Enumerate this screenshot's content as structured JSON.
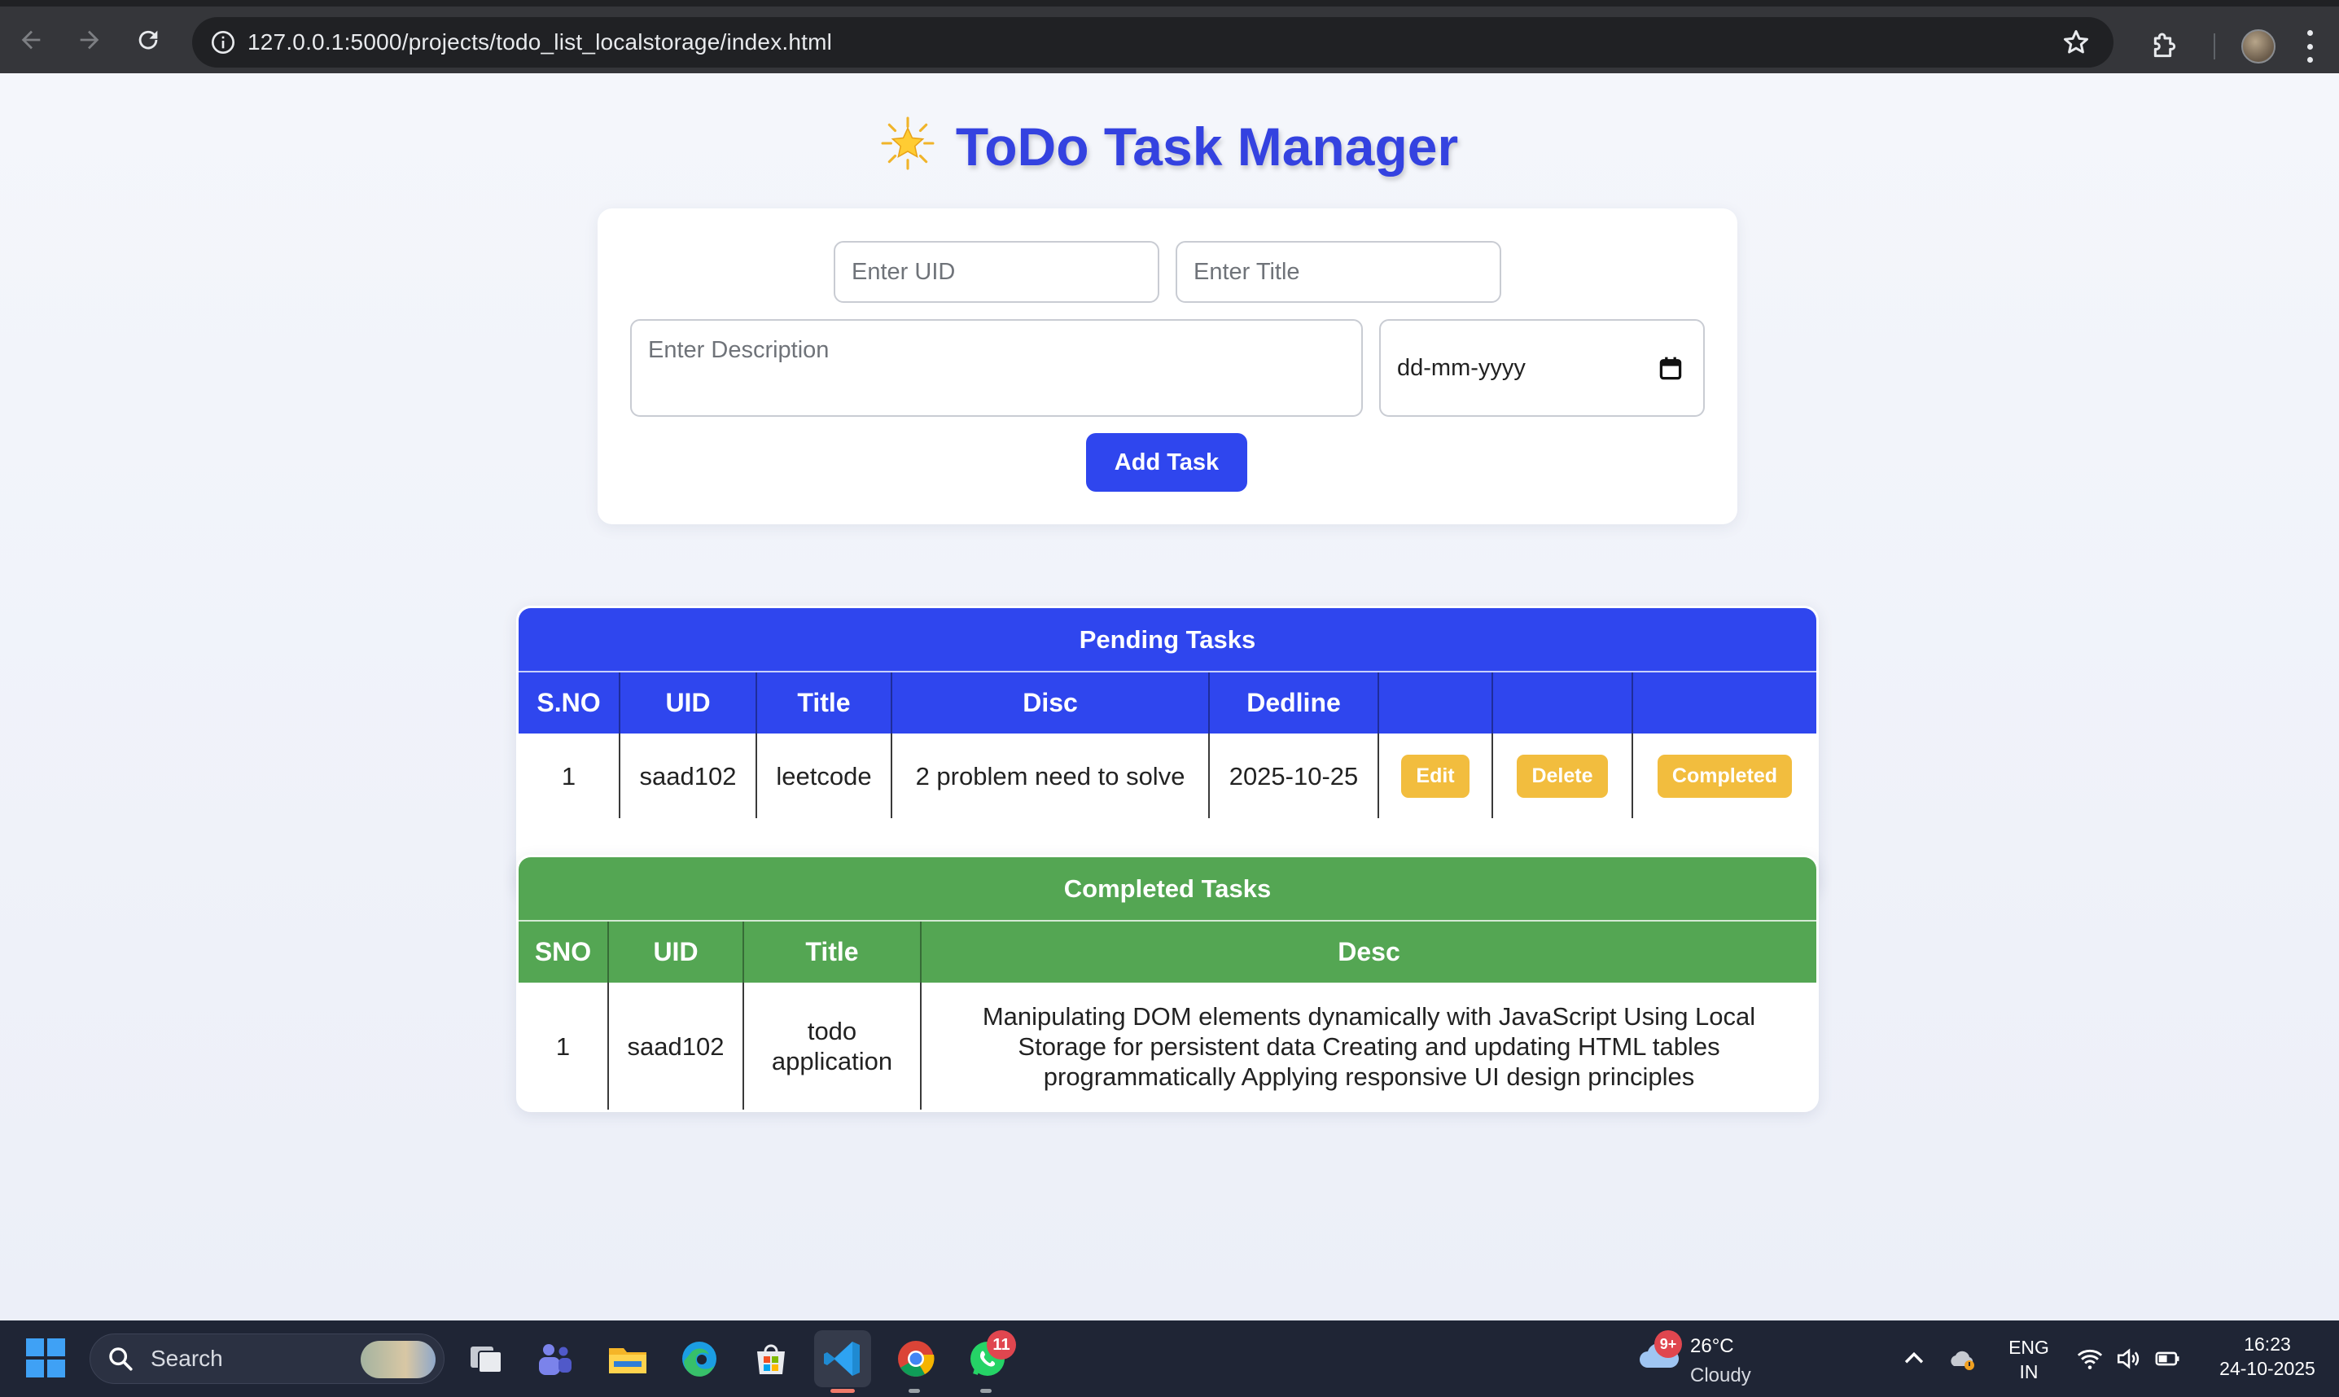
{
  "browser": {
    "url": "127.0.0.1:5000/projects/todo_list_localstorage/index.html"
  },
  "app": {
    "title": "ToDo Task Manager",
    "title_icon": "star-emoji"
  },
  "form": {
    "uid_placeholder": "Enter UID",
    "title_placeholder": "Enter Title",
    "description_placeholder": "Enter Description",
    "date_value": "dd-mm-yyyy",
    "add_button": "Add Task"
  },
  "pending": {
    "caption": "Pending Tasks",
    "accent": "#2f46ee",
    "columns": [
      "S.NO",
      "UID",
      "Title",
      "Disc",
      "Dedline",
      "",
      "",
      ""
    ],
    "rows": [
      {
        "sno": "1",
        "uid": "saad102",
        "title": "leetcode",
        "disc": "2 problem need to solve",
        "deadline": "2025-10-25",
        "edit": "Edit",
        "delete": "Delete",
        "complete": "Completed"
      }
    ]
  },
  "completed": {
    "caption": "Completed Tasks",
    "accent": "#54a653",
    "columns": [
      "SNO",
      "UID",
      "Title",
      "Desc"
    ],
    "rows": [
      {
        "sno": "1",
        "uid": "saad102",
        "title": "todo application",
        "desc": "Manipulating DOM elements dynamically with JavaScript Using Local Storage for persistent data Creating and updating HTML tables programmatically Applying responsive UI design principles"
      }
    ]
  },
  "taskbar": {
    "search_label": "Search",
    "whatsapp_badge": "11",
    "weather_badge": "9+",
    "temperature": "26°C",
    "condition": "Cloudy",
    "language": "ENG",
    "region": "IN",
    "time": "16:23",
    "date": "24-10-2025"
  }
}
